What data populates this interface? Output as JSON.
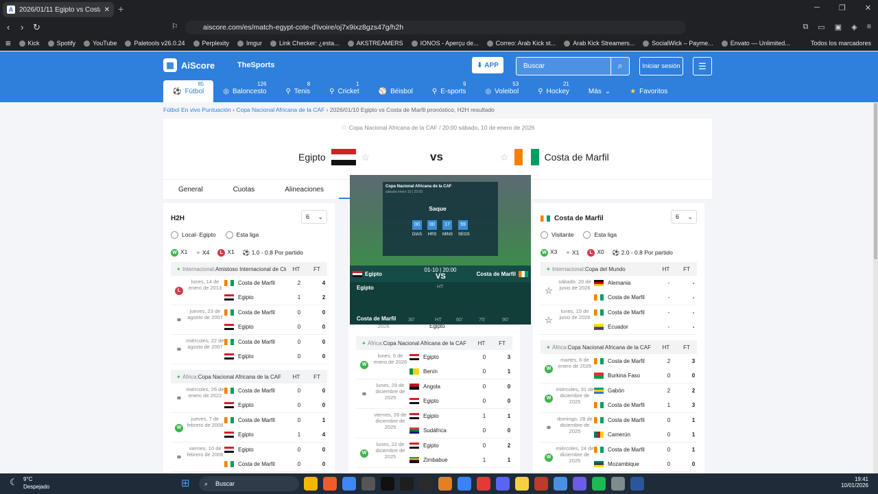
{
  "browser": {
    "tab_title": "2026/01/11 Egipto vs Costa de M",
    "url": "aiscore.com/es/match-egypt-cote-d'ivoire/oj7x9ixz8gzs47g/h2h",
    "bookmarks": [
      "Kick",
      "Spotify",
      "YouTube",
      "Paletools v26.0.24",
      "Perplexity",
      "Imgur",
      "Link Checker: ¿esta...",
      "AKSTREAMERS",
      "IONOS - Aperçu de...",
      "Correo: Arab Kick st...",
      "Arab Kick Streamers...",
      "SocialWick – Payme...",
      "Envato — Unlimited..."
    ],
    "bookmarks_folder": "Todos los marcadores"
  },
  "site": {
    "logo": "AiScore",
    "partner": "TheSports",
    "app_label": "APP",
    "search_placeholder": "Buscar",
    "login": "Iniciar sesión",
    "sports": [
      {
        "label": "Fútbol",
        "count": "85",
        "icon": "⚽"
      },
      {
        "label": "Baloncesto",
        "count": "126",
        "icon": "◎"
      },
      {
        "label": "Tenis",
        "count": "8",
        "icon": "⚲"
      },
      {
        "label": "Cricket",
        "count": "1",
        "icon": "⚲"
      },
      {
        "label": "Béisbol",
        "count": "",
        "icon": "⚾"
      },
      {
        "label": "E-sports",
        "count": "9",
        "icon": "⚲"
      },
      {
        "label": "Voleibol",
        "count": "53",
        "icon": "◎"
      },
      {
        "label": "Hockey",
        "count": "21",
        "icon": "⚲"
      },
      {
        "label": "Más",
        "count": "",
        "icon": ""
      }
    ],
    "favorites": "Favoritos"
  },
  "breadcrumb": {
    "c1": "Fútbol En vivo Puntuación",
    "c2": "Copa Nacional Africana de la CAF",
    "c3": "2026/01/10 Egipto vs Costa de Marfil pronóstico, H2H resultado"
  },
  "match": {
    "competition": "Copa Nacional Africana de la CAF",
    "datetime": "20:00 sábado, 10 de enero de 2026",
    "home": "Egipto",
    "away": "Costa de Marfil",
    "vs": "vs",
    "tabs": [
      "General",
      "Cuotas",
      "Alineaciones",
      "H2H"
    ]
  },
  "h2h": {
    "title": "H2H",
    "select": "6",
    "radio1": "Local- Egipto",
    "radio2": "Esta liga",
    "stats": {
      "w": "X1",
      "d": "X4",
      "l": "X1",
      "goals": "1.0 - 0.8 Por partido"
    },
    "groups": [
      {
        "region": "Internacional:",
        "comp": "Amistoso Internacional de Clubes",
        "matches": [
          {
            "date": "lunes, 14 de enero de 2013",
            "res": "L",
            "t1": "Costa de Marfil",
            "t2": "Egipto",
            "ht1": "2",
            "ht2": "1",
            "ft1": "4",
            "ft2": "2"
          },
          {
            "date": "jueves, 23 de agosto de 2007",
            "res": "D",
            "t1": "Costa de Marfil",
            "t2": "Egipto",
            "ht1": "0",
            "ht2": "0",
            "ft1": "0",
            "ft2": "0"
          },
          {
            "date": "miércoles, 22 de agosto de 2007",
            "res": "D",
            "t1": "Costa de Marfil",
            "t2": "Egipto",
            "ht1": "0",
            "ht2": "0",
            "ft1": "0",
            "ft2": "0"
          }
        ]
      },
      {
        "region": "África:",
        "comp": "Copa Nacional Africana de la CAF",
        "matches": [
          {
            "date": "miércoles, 26 de enero de 2022",
            "res": "D",
            "t1": "Costa de Marfil",
            "t2": "Egipto",
            "ht1": "0",
            "ht2": "0",
            "ft1": "0",
            "ft2": "0"
          },
          {
            "date": "jueves, 7 de febrero de 2008",
            "res": "W",
            "t1": "Costa de Marfil",
            "t2": "Egipto",
            "ht1": "0",
            "ht2": "1",
            "ft1": "1",
            "ft2": "4"
          },
          {
            "date": "viernes, 10 de febrero de 2006",
            "res": "D",
            "t1": "Egipto",
            "t2": "Costa de Marfil",
            "ht1": "0",
            "ht2": "0",
            "ft1": "0",
            "ft2": "0"
          }
        ]
      }
    ],
    "ht": "HT",
    "ft": "FT"
  },
  "middle": {
    "partial_date": "2026",
    "partial_team": "Egipto",
    "region": "África:",
    "comp": "Copa Nacional Africana de la CAF",
    "matches": [
      {
        "date": "lunes, 5 de enero de 2026",
        "res": "W",
        "t1": "Egipto",
        "t2": "Benín",
        "ht1": "0",
        "ht2": "0",
        "ft1": "3",
        "ft2": "1"
      },
      {
        "date": "lunes, 29 de diciembre de 2025",
        "res": "D",
        "t1": "Angola",
        "t2": "Egipto",
        "ht1": "0",
        "ht2": "0",
        "ft1": "0",
        "ft2": "0"
      },
      {
        "date": "viernes, 26 de diciembre de 2025",
        "res": "",
        "t1": "Egipto",
        "t2": "Sudáfrica",
        "ht1": "1",
        "ht2": "0",
        "ft1": "1",
        "ft2": "0"
      },
      {
        "date": "lunes, 22 de diciembre de 2025",
        "res": "W",
        "t1": "Egipto",
        "t2": "Zimbabue",
        "ht1": "0",
        "ht2": "1",
        "ft1": "2",
        "ft2": "1"
      }
    ]
  },
  "right": {
    "title": "Costa de Marfil",
    "select": "6",
    "radio1": "Visitante",
    "radio2": "Esta liga",
    "stats": {
      "w": "X3",
      "d": "X1",
      "l": "X0",
      "goals": "2.0 - 0.8 Por partido"
    },
    "g1_region": "Internacional:",
    "g1_comp": "Copa del Mundo",
    "g1": [
      {
        "date": "sábado, 20 de junio de 2026",
        "res": "S",
        "t1": "Alemania",
        "t2": "Costa de Marfil",
        "ht1": "-",
        "ht2": "-",
        "ft1": "-",
        "ft2": "-"
      },
      {
        "date": "lunes, 15 de junio de 2026",
        "res": "S",
        "t1": "Costa de Marfil",
        "t2": "Ecuador",
        "ht1": "-",
        "ht2": "-",
        "ft1": "-",
        "ft2": "-"
      }
    ],
    "g2_region": "África:",
    "g2_comp": "Copa Nacional Africana de la CAF",
    "g2": [
      {
        "date": "martes, 6 de enero de 2026",
        "res": "W",
        "t1": "Costa de Marfil",
        "t2": "Burkina Faso",
        "ht1": "2",
        "ht2": "0",
        "ft1": "3",
        "ft2": "0"
      },
      {
        "date": "miércoles, 31 de diciembre de 2025",
        "res": "W",
        "t1": "Gabón",
        "t2": "Costa de Marfil",
        "ht1": "2",
        "ht2": "1",
        "ft1": "2",
        "ft2": "3"
      },
      {
        "date": "domingo, 28 de diciembre de 2025",
        "res": "D",
        "t1": "Costa de Marfil",
        "t2": "Camerún",
        "ht1": "0",
        "ht2": "0",
        "ft1": "1",
        "ft2": "1"
      },
      {
        "date": "miércoles, 24 de diciembre de 2025",
        "res": "W",
        "t1": "Costa de Marfil",
        "t2": "Mozambique",
        "ht1": "0",
        "ht2": "0",
        "ft1": "1",
        "ft2": "0"
      }
    ]
  },
  "popup": {
    "comp": "Copa Nacional Africana de la CAF",
    "sub": "sábado enero 10 | 20:00",
    "saque": "Saque",
    "cd": [
      {
        "v": "00",
        "l": "DIAS"
      },
      {
        "v": "00",
        "l": "HRS"
      },
      {
        "v": "17",
        "l": "MINS"
      },
      {
        "v": "59",
        "l": "SEGS"
      }
    ],
    "datetime": "01-10 | 20:00",
    "home": "Egipto",
    "away": "Costa de Marfil",
    "vs": "VS",
    "ht": "HT",
    "ticks": [
      "30'",
      "HT",
      "60'",
      "75'",
      "90'"
    ]
  },
  "taskbar": {
    "temp": "9°C",
    "weather": "Despejado",
    "search": "Buscar",
    "time": "19:41",
    "date": "10/01/2026"
  }
}
